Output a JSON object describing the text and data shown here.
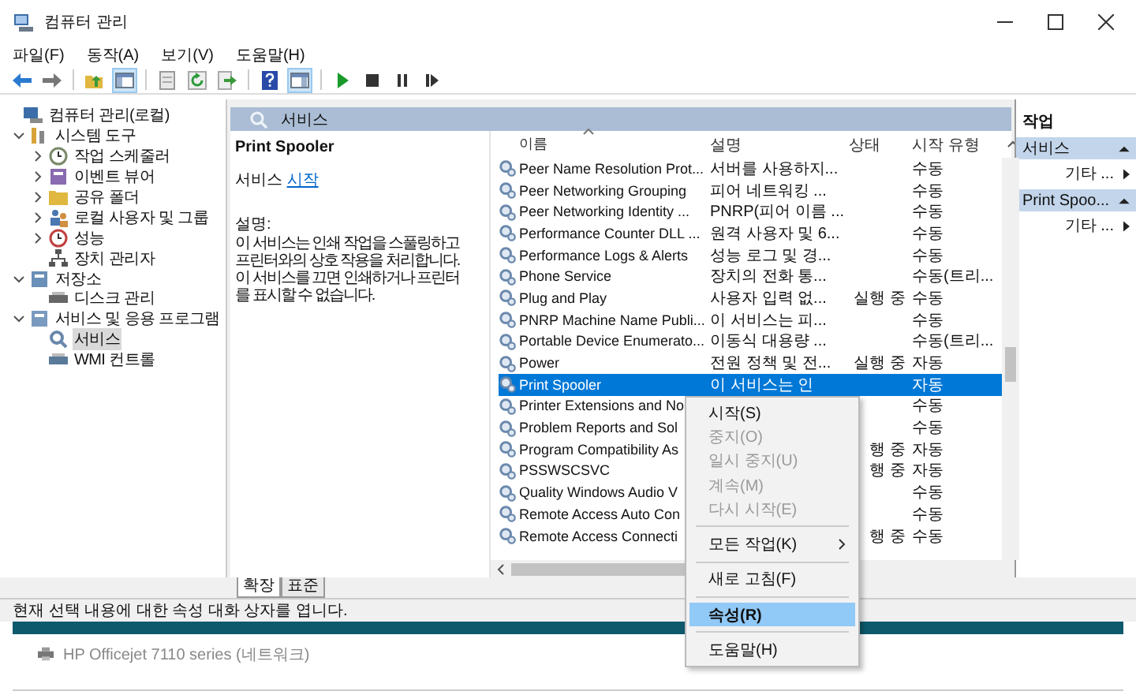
{
  "window": {
    "title": "컴퓨터 관리"
  },
  "menu": [
    "파일(F)",
    "동작(A)",
    "보기(V)",
    "도움말(H)"
  ],
  "toolbar": [
    {
      "kind": "back",
      "pressed": false
    },
    {
      "kind": "forward",
      "pressed": false
    },
    {
      "kind": "separator"
    },
    {
      "kind": "up",
      "pressed": false
    },
    {
      "kind": "tree",
      "pressed": true
    },
    {
      "kind": "separator"
    },
    {
      "kind": "properties",
      "pressed": false
    },
    {
      "kind": "refresh",
      "pressed": false
    },
    {
      "kind": "export",
      "pressed": false
    },
    {
      "kind": "separator"
    },
    {
      "kind": "help",
      "pressed": false
    },
    {
      "kind": "pane",
      "pressed": true
    },
    {
      "kind": "separator"
    },
    {
      "kind": "play",
      "pressed": false
    },
    {
      "kind": "stop",
      "pressed": false
    },
    {
      "kind": "pause",
      "pressed": false
    },
    {
      "kind": "resume",
      "pressed": false
    }
  ],
  "tree": [
    {
      "label": "컴퓨터 관리(로컬)",
      "kind": "computer",
      "selected": false,
      "children": [
        {
          "label": "시스템 도구",
          "kind": "tools",
          "expanded": true,
          "selected": false,
          "children": [
            {
              "label": "작업 스케줄러",
              "kind": "clock",
              "expanded": false,
              "selected": false
            },
            {
              "label": "이벤트 뷰어",
              "kind": "log",
              "expanded": false,
              "selected": false
            },
            {
              "label": "공유 폴더",
              "kind": "folder",
              "expanded": false,
              "selected": false
            },
            {
              "label": "로컬 사용자 및 그룹",
              "kind": "users",
              "expanded": false,
              "selected": false
            },
            {
              "label": "성능",
              "kind": "gauge",
              "expanded": false,
              "selected": false
            },
            {
              "label": "장치 관리자",
              "kind": "network",
              "selected": false
            }
          ]
        },
        {
          "label": "저장소",
          "kind": "storage",
          "expanded": true,
          "selected": false,
          "children": [
            {
              "label": "디스크 관리",
              "kind": "disk",
              "selected": false
            }
          ]
        },
        {
          "label": "서비스 및 응용 프로그램",
          "kind": "apps",
          "expanded": true,
          "selected": false,
          "children": [
            {
              "label": "서비스",
              "kind": "service",
              "selected": true
            },
            {
              "label": "WMI 컨트롤",
              "kind": "wmi",
              "selected": false
            }
          ]
        }
      ]
    }
  ],
  "panel": {
    "header": "서비스",
    "title": "Print Spooler",
    "action_prefix": "서비스",
    "action_link": "시작",
    "description_label": "설명:",
    "description": "이 서비스는 인쇄 작업을 스풀링하고\n프린터와의 상호 작용을 처리합니다.\n이 서비스를 끄면 인쇄하거나 프린터\n를 표시할 수 없습니다."
  },
  "list": {
    "columns": [
      "이름",
      "설명",
      "상태",
      "시작 유형"
    ],
    "rows": [
      {
        "name": "Peer Name Resolution Prot...",
        "description": "서버를 사용하지...",
        "status": "",
        "startup": "수동",
        "selected": false
      },
      {
        "name": "Peer Networking Grouping",
        "description": "피어 네트워킹 ...",
        "status": "",
        "startup": "수동",
        "selected": false
      },
      {
        "name": "Peer Networking Identity ...",
        "description": "PNRP(피어 이름 ...",
        "status": "",
        "startup": "수동",
        "selected": false
      },
      {
        "name": "Performance Counter DLL ...",
        "description": "원격 사용자 및 6...",
        "status": "",
        "startup": "수동",
        "selected": false
      },
      {
        "name": "Performance Logs & Alerts",
        "description": "성능 로그 및 경...",
        "status": "",
        "startup": "수동",
        "selected": false
      },
      {
        "name": "Phone Service",
        "description": "장치의 전화 통...",
        "status": "",
        "startup": "수동(트리...",
        "selected": false
      },
      {
        "name": "Plug and Play",
        "description": "사용자 입력 없...",
        "status": "실행 중",
        "startup": "수동",
        "selected": false
      },
      {
        "name": "PNRP Machine Name Publi...",
        "description": "이 서비스는 피...",
        "status": "",
        "startup": "수동",
        "selected": false
      },
      {
        "name": "Portable Device Enumerato...",
        "description": "이동식 대용량 ...",
        "status": "",
        "startup": "수동(트리...",
        "selected": false
      },
      {
        "name": "Power",
        "description": "전원 정책 및 전...",
        "status": "실행 중",
        "startup": "자동",
        "selected": false
      },
      {
        "name": "Print Spooler",
        "description": "이 서비스는 인",
        "status": "",
        "startup": "자동",
        "selected": true
      },
      {
        "name": "Printer Extensions and No",
        "description": "",
        "status": "",
        "startup": "수동",
        "selected": false
      },
      {
        "name": "Problem Reports and Sol",
        "description": "",
        "status": "",
        "startup": "수동",
        "selected": false
      },
      {
        "name": "Program Compatibility As",
        "description": "",
        "status": "행 중",
        "startup": "자동",
        "selected": false
      },
      {
        "name": "PSSWSCSVC",
        "description": "",
        "status": "행 중",
        "startup": "자동",
        "selected": false
      },
      {
        "name": "Quality Windows Audio V",
        "description": "",
        "status": "",
        "startup": "수동",
        "selected": false
      },
      {
        "name": "Remote Access Auto Con",
        "description": "",
        "status": "",
        "startup": "수동",
        "selected": false
      },
      {
        "name": "Remote Access Connecti",
        "description": "",
        "status": "행 중",
        "startup": "수동",
        "selected": false
      }
    ]
  },
  "context_menu": {
    "items": [
      {
        "kind": "item",
        "label": "시작(S)",
        "disabled": false,
        "selected": false,
        "default": false
      },
      {
        "kind": "item",
        "label": "중지(O)",
        "disabled": true,
        "selected": false,
        "default": false
      },
      {
        "kind": "item",
        "label": "일시 중지(U)",
        "disabled": true,
        "selected": false,
        "default": false
      },
      {
        "kind": "item",
        "label": "계속(M)",
        "disabled": true,
        "selected": false,
        "default": false
      },
      {
        "kind": "item",
        "label": "다시 시작(E)",
        "disabled": true,
        "selected": false,
        "default": false
      },
      {
        "kind": "separator"
      },
      {
        "kind": "submenu",
        "label": "모든 작업(K)",
        "disabled": false,
        "selected": false,
        "default": false
      },
      {
        "kind": "separator"
      },
      {
        "kind": "item",
        "label": "새로 고침(F)",
        "disabled": false,
        "selected": false,
        "default": false
      },
      {
        "kind": "separator"
      },
      {
        "kind": "item",
        "label": "속성(R)",
        "disabled": false,
        "selected": true,
        "default": true
      },
      {
        "kind": "separator"
      },
      {
        "kind": "item",
        "label": "도움말(H)",
        "disabled": false,
        "selected": false,
        "default": false
      }
    ]
  },
  "actions": {
    "title": "작업",
    "sections": [
      {
        "title": "서비스",
        "expanded": true,
        "items": [
          "기타 ..."
        ]
      },
      {
        "title": "Print Spoo...",
        "expanded": true,
        "items": [
          "기타 ..."
        ]
      }
    ]
  },
  "view_tabs": [
    {
      "label": "확장",
      "selected": true
    },
    {
      "label": "표준",
      "selected": false
    }
  ],
  "status_bar": "현재 선택 내용에 대한 속성 대화 상자를 엽니다.",
  "background_window": {
    "item": "HP Officejet 7110 series (네트워크)"
  }
}
